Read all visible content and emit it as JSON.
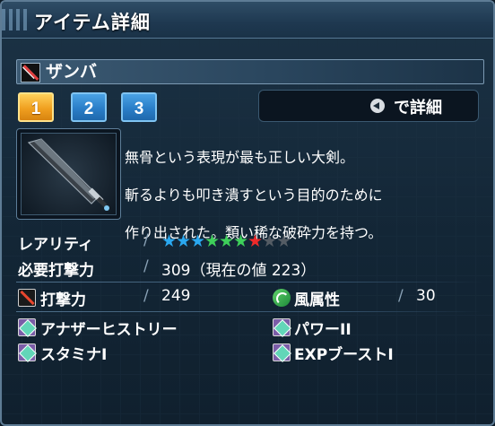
{
  "window": {
    "title": "アイテム詳細"
  },
  "item": {
    "name": "ザンバ"
  },
  "tabs": [
    {
      "label": "1",
      "active": true
    },
    {
      "label": "2",
      "active": false
    },
    {
      "label": "3",
      "active": false
    }
  ],
  "detail_hint": {
    "icon": "back-button-icon",
    "label": "で詳細"
  },
  "description": {
    "lines": [
      "無骨という表現が最も正しい大剣。",
      "斬るよりも叩き潰すという目的のために",
      "作り出された。類い稀な破砕力を持つ。"
    ]
  },
  "rarity": {
    "label": "レアリティ",
    "stars_filled": 7,
    "stars_total": 9,
    "star_colors": [
      "#2aa8f0",
      "#2aa8f0",
      "#2aa8f0",
      "#3ed05a",
      "#3ed05a",
      "#3ed05a",
      "#ee2a2a",
      "#545c64",
      "#545c64"
    ]
  },
  "required_attack": {
    "label": "必要打撃力",
    "value": "309（現在の値 223）"
  },
  "stats": {
    "attack": {
      "label": "打撃力",
      "value": "249",
      "icon": "striking-power-icon"
    },
    "element": {
      "label": "風属性",
      "value": "30",
      "icon": "wind-element-icon"
    }
  },
  "abilities": [
    {
      "label": "アナザーヒストリー",
      "icon": "ability-icon"
    },
    {
      "label": "パワーII",
      "icon": "ability-icon"
    },
    {
      "label": "スタミナI",
      "icon": "ability-icon"
    },
    {
      "label": "EXPブーストI",
      "icon": "ability-icon"
    }
  ],
  "colors": {
    "tab_active": "#f0a020",
    "tab_inactive": "#2a7ec8",
    "panel_border": "#5e7c95"
  }
}
